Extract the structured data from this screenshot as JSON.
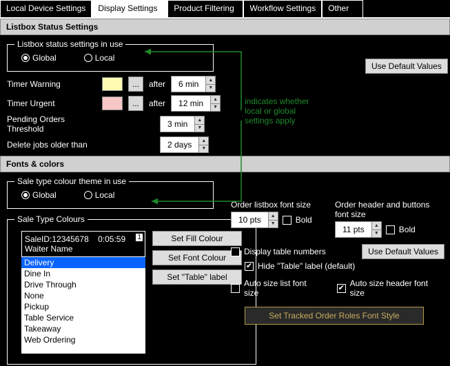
{
  "tabs": {
    "local_device": "Local Device Settings",
    "display": "Display Settings",
    "product_filtering": "Product Filtering",
    "workflow": "Workflow Settings",
    "other": "Other"
  },
  "sections": {
    "listbox_status_header": "Listbox Status Settings",
    "fonts_colors_header": "Fonts & colors"
  },
  "listbox_status": {
    "legend": "Listbox status settings in use",
    "global": "Global",
    "local": "Local",
    "timer_warning_label": "Timer Warning",
    "timer_urgent_label": "Timer Urgent",
    "after": "after",
    "timer_warning_value": "6 min",
    "timer_urgent_value": "12 min",
    "pending_label": "Pending Orders Threshold",
    "pending_value": "3 min",
    "delete_label": "Delete jobs older than",
    "delete_value": "2 days",
    "dots": "...",
    "use_defaults": "Use Default Values",
    "warning_color": "#fdfab2",
    "urgent_color": "#f7c6c6"
  },
  "sale_type": {
    "theme_legend": "Sale type colour theme in use",
    "global": "Global",
    "local": "Local",
    "colours_legend": "Sale Type Colours",
    "sample_sale": "SaleID:12345678",
    "sample_time": "0:05:59",
    "sample_badge": "1",
    "sample_waiter": "Waiter Name",
    "items": [
      "Delivery",
      "Dine In",
      "Drive Through",
      "None",
      "Pickup",
      "Table Service",
      "Takeaway",
      "Web Ordering"
    ],
    "set_fill": "Set Fill Colour",
    "set_font": "Set Font Colour",
    "set_table": "Set \"Table\" label"
  },
  "fonts": {
    "order_listbox_label": "Order listbox  font size",
    "order_header_label": "Order header and buttons font size",
    "listbox_size": "10 pts",
    "header_size": "11 pts",
    "bold": "Bold",
    "display_table_numbers": "Display table numbers",
    "hide_table_label": "Hide \"Table\" label (default)",
    "auto_size_list": "Auto size list font size",
    "auto_size_header": "Auto size header font size",
    "use_defaults": "Use Default Values",
    "tracked_roles": "Set Tracked Order Roles Font Style"
  },
  "annotation": {
    "line1": "indicates whether",
    "line2": "local or global",
    "line3": "settings apply"
  }
}
